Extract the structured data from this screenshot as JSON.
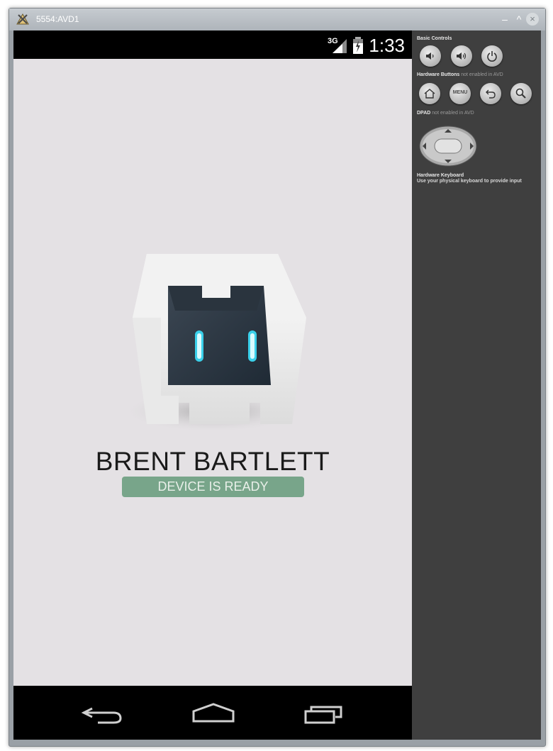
{
  "window": {
    "title": "5554:AVD1",
    "minimize": "–",
    "maximize": "^",
    "close": "×"
  },
  "statusbar": {
    "network": "3G",
    "time": "1:33"
  },
  "app": {
    "name": "BRENT BARTLETT",
    "status": "DEVICE IS READY"
  },
  "panel": {
    "basic_controls": "Basic Controls",
    "hardware_buttons": "Hardware Buttons",
    "hardware_buttons_note": "not enabled in AVD",
    "dpad": "DPAD",
    "dpad_note": "not enabled in AVD",
    "keyboard_title": "Hardware Keyboard",
    "keyboard_note": "Use your physical keyboard to provide input",
    "menu_label": "MENU"
  },
  "colors": {
    "ready_badge": "#78a58a",
    "screen_bg": "#e4e1e4",
    "panel_bg": "#3f3f3f"
  },
  "icons": [
    "volume-down-icon",
    "volume-up-icon",
    "power-icon",
    "home-icon",
    "menu-icon",
    "back-icon",
    "search-icon",
    "dpad-icon",
    "nav-back-icon",
    "nav-home-icon",
    "nav-recent-icon"
  ]
}
